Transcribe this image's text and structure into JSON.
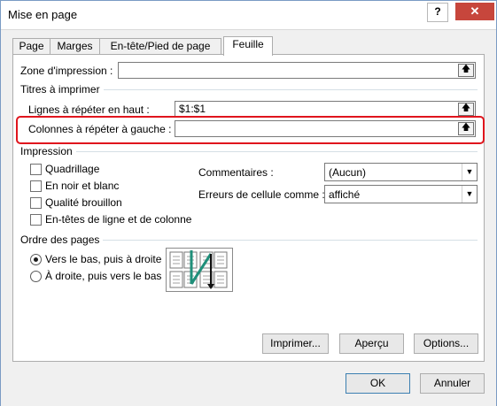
{
  "window": {
    "title": "Mise en page",
    "help_label": "?",
    "close_label": "✕"
  },
  "tabs": [
    {
      "label": "Page"
    },
    {
      "label": "Marges"
    },
    {
      "label": "En-tête/Pied de page"
    },
    {
      "label": "Feuille"
    }
  ],
  "print_area": {
    "label": "Zone d'impression :",
    "value": ""
  },
  "titles": {
    "group_label": "Titres à imprimer",
    "rows_label": "Lignes à répéter en haut :",
    "rows_value": "$1:$1",
    "cols_label": "Colonnes à répéter à gauche :",
    "cols_value": ""
  },
  "print": {
    "group_label": "Impression",
    "gridlines": "Quadrillage",
    "black_white": "En noir et blanc",
    "draft": "Qualité brouillon",
    "headings": "En-têtes de ligne et de colonne",
    "comments_label": "Commentaires :",
    "comments_value": "(Aucun)",
    "errors_label": "Erreurs de cellule comme :",
    "errors_value": "affiché"
  },
  "page_order": {
    "group_label": "Ordre des pages",
    "down_then_over": "Vers le bas, puis à droite",
    "over_then_down": "À droite, puis vers le bas",
    "selected": "down_then_over"
  },
  "buttons": {
    "print": "Imprimer...",
    "preview": "Aperçu",
    "options": "Options...",
    "ok": "OK",
    "cancel": "Annuler"
  },
  "colors": {
    "highlight": "#e0151d",
    "close": "#c7463c",
    "accent": "#3c7fb1"
  },
  "icons": {
    "ref": "collapse-dialog-icon",
    "page_order": "page-order-preview-icon"
  }
}
